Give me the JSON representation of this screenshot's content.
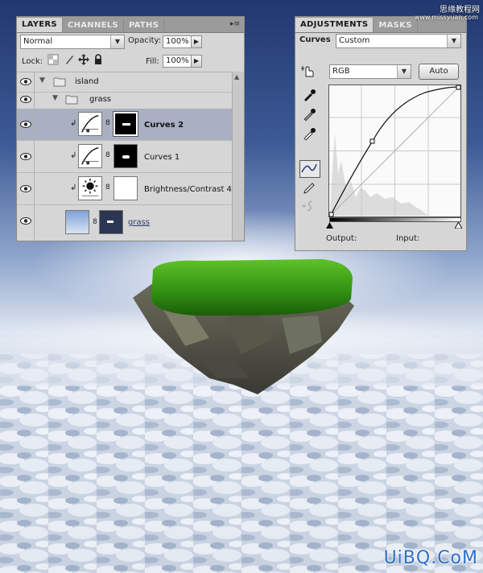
{
  "layers_panel": {
    "tabs": [
      {
        "label": "LAYERS"
      },
      {
        "label": "CHANNELS"
      },
      {
        "label": "PATHS"
      }
    ],
    "blend_mode": "Normal",
    "opacity_label": "Opacity:",
    "opacity_value": "100%",
    "lock_label": "Lock:",
    "fill_label": "Fill:",
    "fill_value": "100%",
    "groups": [
      {
        "name": "island"
      },
      {
        "name": "grass"
      }
    ],
    "layers": [
      {
        "name": "Curves 2",
        "selected": true
      },
      {
        "name": "Curves 1",
        "selected": false
      },
      {
        "name": "Brightness/Contrast 4",
        "selected": false
      },
      {
        "name": "grass",
        "selected": false
      }
    ]
  },
  "adjustments_panel": {
    "tabs": [
      {
        "label": "ADJUSTMENTS"
      },
      {
        "label": "MASKS"
      }
    ],
    "title": "Curves",
    "preset": "Custom",
    "channel": "RGB",
    "auto_label": "Auto",
    "output_label": "Output:",
    "input_label": "Input:"
  },
  "watermark": {
    "top": "思缘教程网",
    "top_sub": "www.missyuan.com",
    "bottom": "UiBQ.CoM"
  },
  "colors": {
    "panel_bg": "#d6d6d6",
    "selected_row": "#a9b0c2",
    "tab_bar": "#9b9b9b"
  }
}
